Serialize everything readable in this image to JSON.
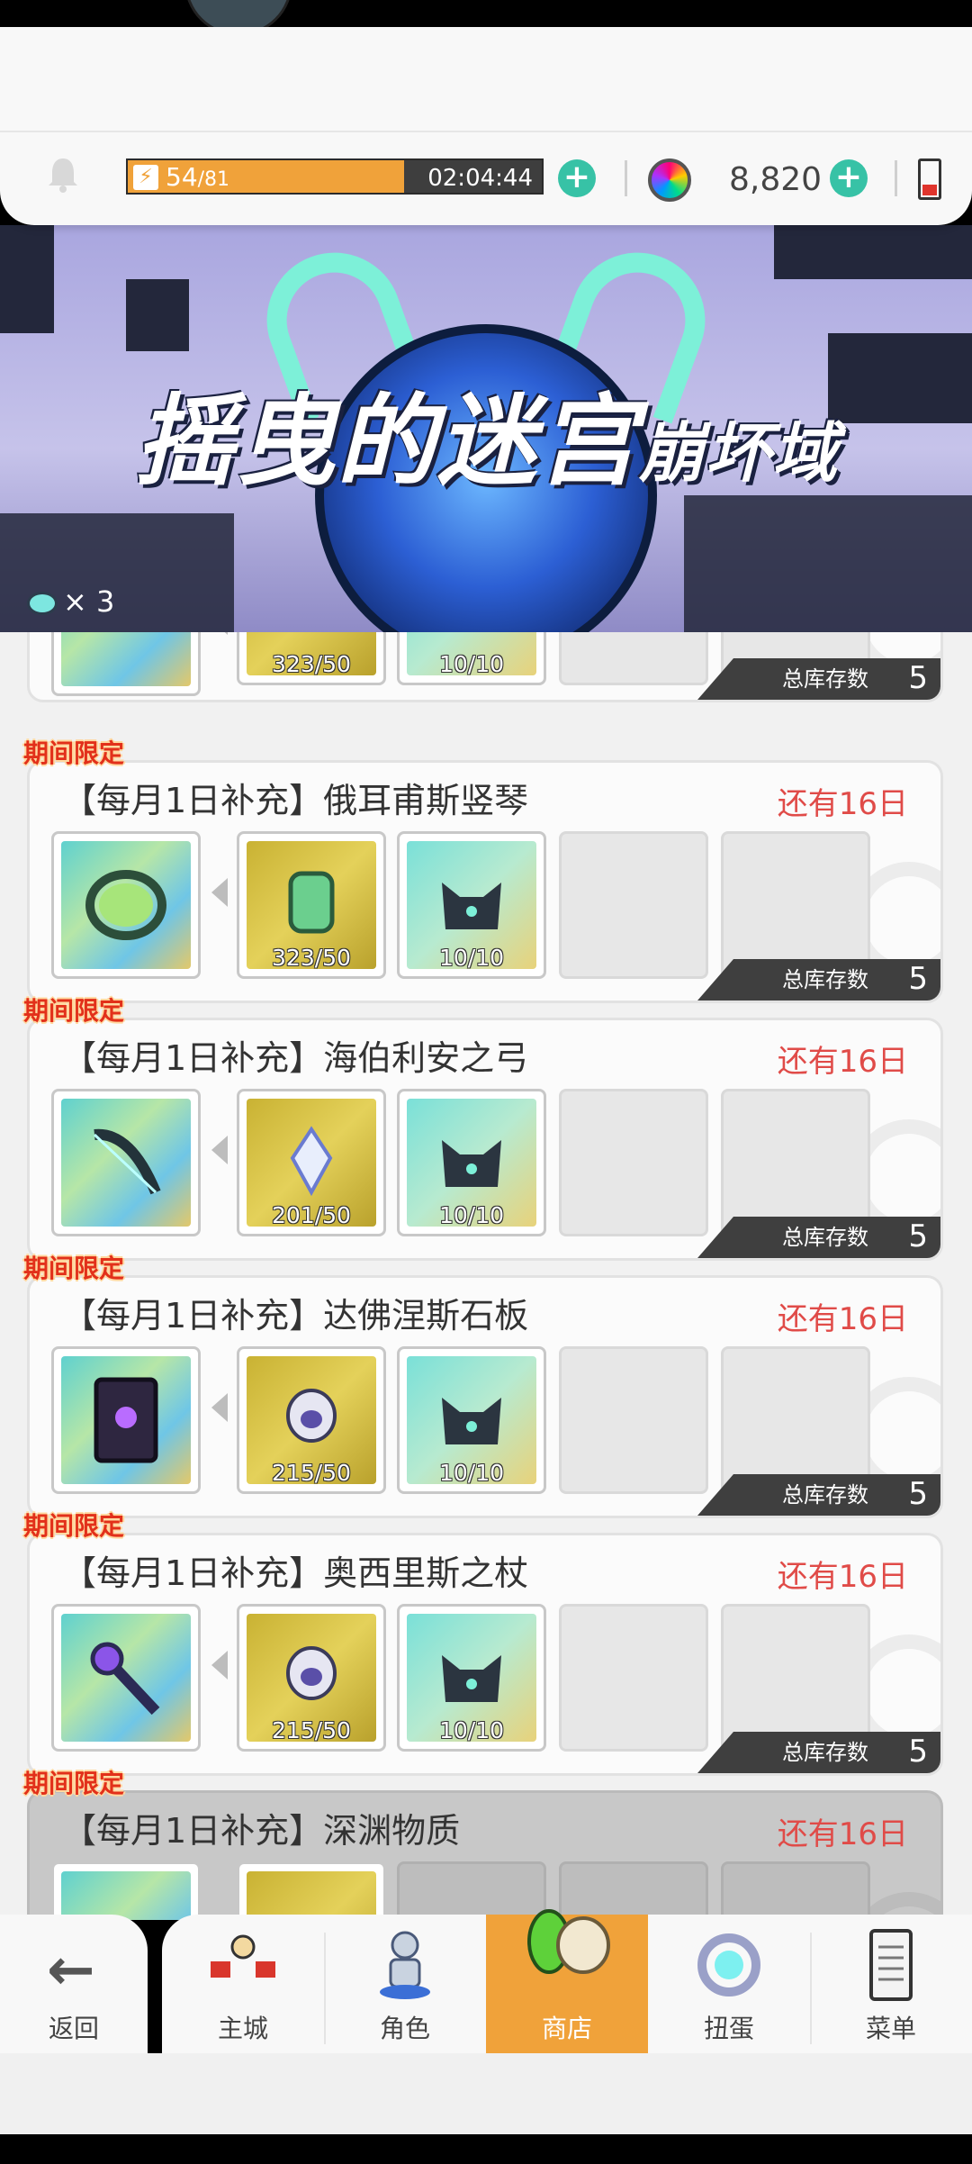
{
  "status_bar": {
    "energy_current": "54",
    "energy_max": "/81",
    "energy_level": 0.6667,
    "energy_timer": "02:04:44",
    "gems": "8,820"
  },
  "banner": {
    "title_part1": "摇曳的迷宫",
    "title_part2": "崩坏域",
    "keys": "× 3"
  },
  "labels": {
    "limited": "期间限定",
    "stock": "总库存数"
  },
  "cards": [
    {
      "title": "",
      "days": "",
      "result_icon": "scythe-icon",
      "materials": [
        {
          "icon": "green-armor-icon",
          "count": "323/50"
        },
        {
          "icon": "dark-cat-icon",
          "count": "10/10"
        }
      ],
      "stock": "5"
    },
    {
      "title": "【每月1日补充】俄耳甫斯竖琴",
      "days": "还有16日",
      "result_icon": "harp-icon",
      "materials": [
        {
          "icon": "green-armor-icon",
          "count": "323/50"
        },
        {
          "icon": "dark-cat-icon",
          "count": "10/10"
        }
      ],
      "stock": "5"
    },
    {
      "title": "【每月1日补充】海伯利安之弓",
      "days": "还有16日",
      "result_icon": "bow-icon",
      "materials": [
        {
          "icon": "crystal-wings-icon",
          "count": "201/50"
        },
        {
          "icon": "dark-cat-icon",
          "count": "10/10"
        }
      ],
      "stock": "5"
    },
    {
      "title": "【每月1日补充】达佛涅斯石板",
      "days": "还有16日",
      "result_icon": "stone-tablet-icon",
      "materials": [
        {
          "icon": "silver-helmet-icon",
          "count": "215/50"
        },
        {
          "icon": "dark-cat-icon",
          "count": "10/10"
        }
      ],
      "stock": "5"
    },
    {
      "title": "【每月1日补充】奥西里斯之杖",
      "days": "还有16日",
      "result_icon": "staff-icon",
      "materials": [
        {
          "icon": "silver-helmet-icon",
          "count": "215/50"
        },
        {
          "icon": "dark-cat-icon",
          "count": "10/10"
        }
      ],
      "stock": "5"
    },
    {
      "title": "【每月1日补充】深渊物质",
      "days": "还有16日",
      "result_icon": "abyss-matter-icon",
      "materials": [
        {
          "icon": "dark-orb-icon",
          "count": ""
        }
      ],
      "stock": ""
    }
  ],
  "nav": {
    "back": "返回",
    "items": [
      {
        "label": "主城",
        "icon": "castle-icon"
      },
      {
        "label": "角色",
        "icon": "character-icon"
      },
      {
        "label": "商店",
        "icon": "shop-icon",
        "active": true
      },
      {
        "label": "扭蛋",
        "icon": "gacha-icon"
      },
      {
        "label": "菜单",
        "icon": "menu-icon"
      }
    ]
  },
  "colors": {
    "accent_orange": "#f0a23a",
    "teal_plus": "#37c2a6",
    "days_red": "#e04b48",
    "limited_red": "#e2301a"
  }
}
